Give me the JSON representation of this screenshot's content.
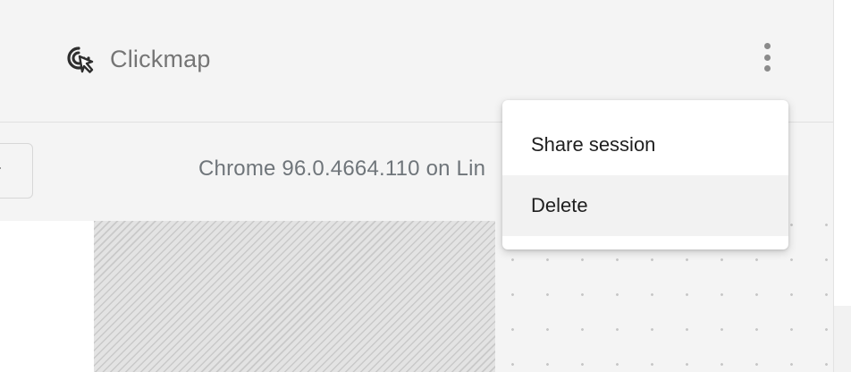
{
  "header": {
    "brand_label": "Clickmap",
    "brand_icon": "cursor-click-icon",
    "more_icon": "kebab-menu-icon"
  },
  "toolbar": {
    "browser_info": "Chrome 96.0.4664.110 on Lin"
  },
  "menu": {
    "items": [
      {
        "label": "Share session",
        "highlighted": false
      },
      {
        "label": "Delete",
        "highlighted": true
      }
    ]
  },
  "colors": {
    "background": "#f4f4f4",
    "menu_background": "#ffffff",
    "menu_highlight": "#f2f2f2",
    "brand_text": "#757575",
    "info_text": "#6f757a"
  }
}
